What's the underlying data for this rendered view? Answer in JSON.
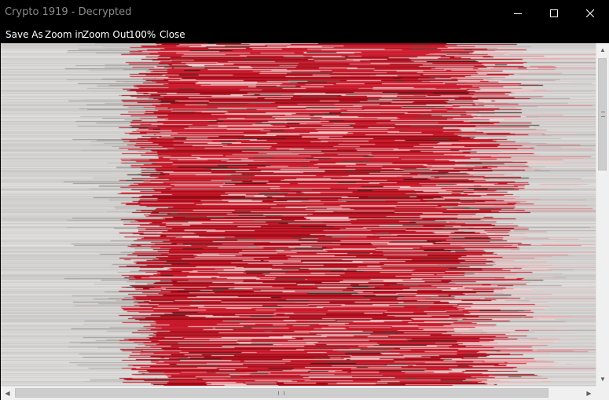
{
  "window": {
    "title": "Crypto 1919 - Decrypted"
  },
  "title_buttons": {
    "minimize_icon": "minimize-icon",
    "maximize_icon": "maximize-icon",
    "close_icon": "close-icon"
  },
  "menu": {
    "items": [
      {
        "label": "Save As"
      },
      {
        "label": "Zoom in"
      },
      {
        "label": "Zoom Out"
      },
      {
        "label": "100%"
      },
      {
        "label": "Close"
      }
    ]
  },
  "colors": {
    "background_gray": "#d7d5d2",
    "glitch_red": "#b8101e",
    "glitch_pink": "#e7a7ab"
  }
}
